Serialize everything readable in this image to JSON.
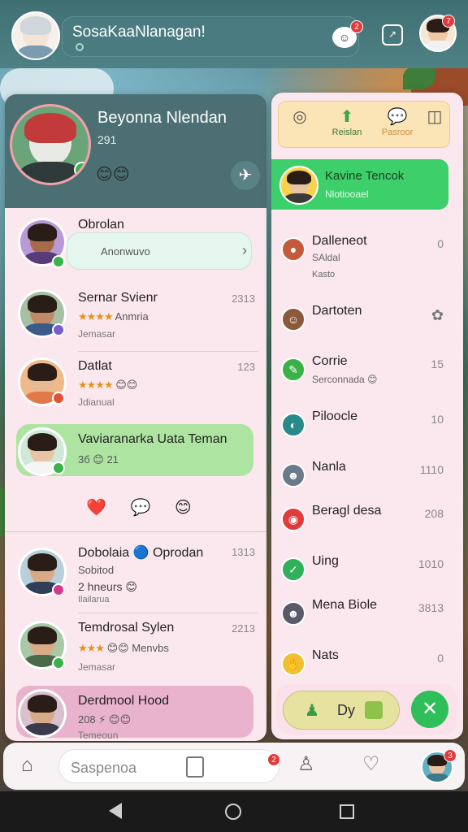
{
  "topbar": {
    "title": "SosaKaaNlanagan!",
    "notification_count": "2",
    "profile_count": "7"
  },
  "profile": {
    "name": "Beyonna Nlendan",
    "count": "291",
    "emojis": "😊😊"
  },
  "left_list": [
    {
      "title": "Obrolan",
      "line2": "Anonwuvo",
      "time": ""
    },
    {
      "title": "Sernar Svienr",
      "line2": "Anmria",
      "line3": "Jemasar",
      "time": "2313"
    },
    {
      "title": "Datlat",
      "line3": "Jdianual",
      "time": "123"
    },
    {
      "title": "Vaviaranarka Uata Teman",
      "line2": "3б 😊 21",
      "time": ""
    },
    {
      "title": "Dobolaia 🔵 Oprodan",
      "line2": "Sobitod",
      "line3": "2 hneurs 😊",
      "line4": "Ilailarua",
      "time": "1313"
    },
    {
      "title": "Temdrosal Sylen",
      "line2": "Menvbs",
      "line3": "Jemasar",
      "time": "2213"
    },
    {
      "title": "Derdmool Hood",
      "line2": "208 ⚡ 😊😊",
      "line3": "Temeoun",
      "time": ""
    }
  ],
  "reactions": "❤️ 💬 😊",
  "right_panel": {
    "tabs": [
      {
        "label": "",
        "icon": "compass-icon"
      },
      {
        "label": "Reislan",
        "icon": "pin-icon"
      },
      {
        "label": "Pasroor",
        "icon": "chat-icon"
      },
      {
        "label": "",
        "icon": "layout-icon"
      }
    ],
    "active": {
      "title": "Kavine Tencok",
      "subtitle": "Nlotiooael"
    },
    "items": [
      {
        "label": "Dalleneot",
        "sub": "SAldal",
        "sub2": "Kasto",
        "num": "0"
      },
      {
        "label": "Dartoten",
        "num": ""
      },
      {
        "label": "Corrie",
        "sub": "Serconnada 😊",
        "num": "15"
      },
      {
        "label": "Piloocle",
        "num": "10"
      },
      {
        "label": "Nanla",
        "num": "1110"
      },
      {
        "label": "Beragl desa",
        "num": "208"
      },
      {
        "label": "Uing",
        "num": "1010"
      },
      {
        "label": "Mena Biole",
        "num": "3813"
      },
      {
        "label": "Nats",
        "num": "0"
      }
    ],
    "action_label": "Dy"
  },
  "tabbar": {
    "search_placeholder": "Saspenoa",
    "notif_count": "2",
    "me_count": "3"
  },
  "colors": {
    "accent_green": "#3ccf6a",
    "panel_pink": "#fbe8ee",
    "header_teal": "#4b6f72"
  }
}
